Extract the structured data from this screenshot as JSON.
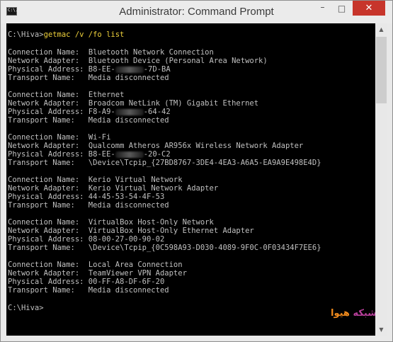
{
  "window": {
    "title": "Administrator: Command Prompt",
    "icon_text": "C:\\.",
    "controls": {
      "minimize": "–",
      "maximize": "□",
      "close": "✕"
    }
  },
  "console": {
    "prompt_path": "C:\\Hiva>",
    "command": "getmac /v /fo list",
    "entries": [
      {
        "connection_label": "Connection Name:",
        "connection_value": "Bluetooth Network Connection",
        "adapter_label": "Network Adapter:",
        "adapter_value": "Bluetooth Device (Personal Area Network)",
        "physical_label": "Physical Address:",
        "physical_prefix": "B8-EE-",
        "physical_suffix": "-7D-BA",
        "transport_label": "Transport Name:",
        "transport_value": "Media disconnected"
      },
      {
        "connection_label": "Connection Name:",
        "connection_value": "Ethernet",
        "adapter_label": "Network Adapter:",
        "adapter_value": "Broadcom NetLink (TM) Gigabit Ethernet",
        "physical_label": "Physical Address:",
        "physical_prefix": "F8-A9-",
        "physical_suffix": "-64-42",
        "transport_label": "Transport Name:",
        "transport_value": "Media disconnected"
      },
      {
        "connection_label": "Connection Name:",
        "connection_value": "Wi-Fi",
        "adapter_label": "Network Adapter:",
        "adapter_value": "Qualcomm Atheros AR956x Wireless Network Adapter",
        "physical_label": "Physical Address:",
        "physical_prefix": "B8-EE-",
        "physical_suffix": "-20-C2",
        "transport_label": "Transport Name:",
        "transport_value": "\\Device\\Tcpip_{27BD8767-3DE4-4EA3-A6A5-EA9A9E498E4D}"
      },
      {
        "connection_label": "Connection Name:",
        "connection_value": "Kerio Virtual Network",
        "adapter_label": "Network Adapter:",
        "adapter_value": "Kerio Virtual Network Adapter",
        "physical_label": "Physical Address:",
        "physical_value": "44-45-53-54-4F-53",
        "transport_label": "Transport Name:",
        "transport_value": "Media disconnected"
      },
      {
        "connection_label": "Connection Name:",
        "connection_value": "VirtualBox Host-Only Network",
        "adapter_label": "Network Adapter:",
        "adapter_value": "VirtualBox Host-Only Ethernet Adapter",
        "physical_label": "Physical Address:",
        "physical_value": "08-00-27-00-90-02",
        "transport_label": "Transport Name:",
        "transport_value": "\\Device\\Tcpip_{0C598A93-D030-4089-9F0C-0F03434F7EE6}"
      },
      {
        "connection_label": "Connection Name:",
        "connection_value": "Local Area Connection",
        "adapter_label": "Network Adapter:",
        "adapter_value": "TeamViewer VPN Adapter",
        "physical_label": "Physical Address:",
        "physical_value": "00-FF-A8-DF-6F-20",
        "transport_label": "Transport Name:",
        "transport_value": "Media disconnected"
      }
    ],
    "final_prompt": "C:\\Hiva>"
  },
  "watermark": {
    "part_a": "هیوا",
    "part_b": "شبکه"
  },
  "scrollbar": {
    "up_arrow": "▲",
    "down_arrow": "▼"
  },
  "colors": {
    "console_bg": "#000000",
    "console_text": "#c0c0c0",
    "command_text": "#f0d23c",
    "close_button": "#c7352b"
  }
}
